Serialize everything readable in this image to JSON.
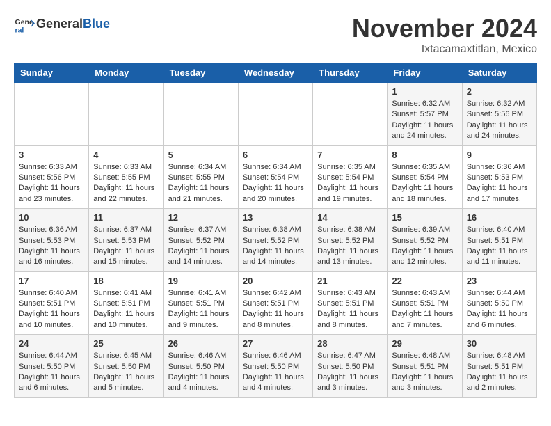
{
  "header": {
    "logo_line1": "General",
    "logo_line2": "Blue",
    "month": "November 2024",
    "location": "Ixtacamaxtitlan, Mexico"
  },
  "days_of_week": [
    "Sunday",
    "Monday",
    "Tuesday",
    "Wednesday",
    "Thursday",
    "Friday",
    "Saturday"
  ],
  "weeks": [
    [
      {
        "day": "",
        "info": ""
      },
      {
        "day": "",
        "info": ""
      },
      {
        "day": "",
        "info": ""
      },
      {
        "day": "",
        "info": ""
      },
      {
        "day": "",
        "info": ""
      },
      {
        "day": "1",
        "info": "Sunrise: 6:32 AM\nSunset: 5:57 PM\nDaylight: 11 hours and 24 minutes."
      },
      {
        "day": "2",
        "info": "Sunrise: 6:32 AM\nSunset: 5:56 PM\nDaylight: 11 hours and 24 minutes."
      }
    ],
    [
      {
        "day": "3",
        "info": "Sunrise: 6:33 AM\nSunset: 5:56 PM\nDaylight: 11 hours and 23 minutes."
      },
      {
        "day": "4",
        "info": "Sunrise: 6:33 AM\nSunset: 5:55 PM\nDaylight: 11 hours and 22 minutes."
      },
      {
        "day": "5",
        "info": "Sunrise: 6:34 AM\nSunset: 5:55 PM\nDaylight: 11 hours and 21 minutes."
      },
      {
        "day": "6",
        "info": "Sunrise: 6:34 AM\nSunset: 5:54 PM\nDaylight: 11 hours and 20 minutes."
      },
      {
        "day": "7",
        "info": "Sunrise: 6:35 AM\nSunset: 5:54 PM\nDaylight: 11 hours and 19 minutes."
      },
      {
        "day": "8",
        "info": "Sunrise: 6:35 AM\nSunset: 5:54 PM\nDaylight: 11 hours and 18 minutes."
      },
      {
        "day": "9",
        "info": "Sunrise: 6:36 AM\nSunset: 5:53 PM\nDaylight: 11 hours and 17 minutes."
      }
    ],
    [
      {
        "day": "10",
        "info": "Sunrise: 6:36 AM\nSunset: 5:53 PM\nDaylight: 11 hours and 16 minutes."
      },
      {
        "day": "11",
        "info": "Sunrise: 6:37 AM\nSunset: 5:53 PM\nDaylight: 11 hours and 15 minutes."
      },
      {
        "day": "12",
        "info": "Sunrise: 6:37 AM\nSunset: 5:52 PM\nDaylight: 11 hours and 14 minutes."
      },
      {
        "day": "13",
        "info": "Sunrise: 6:38 AM\nSunset: 5:52 PM\nDaylight: 11 hours and 14 minutes."
      },
      {
        "day": "14",
        "info": "Sunrise: 6:38 AM\nSunset: 5:52 PM\nDaylight: 11 hours and 13 minutes."
      },
      {
        "day": "15",
        "info": "Sunrise: 6:39 AM\nSunset: 5:52 PM\nDaylight: 11 hours and 12 minutes."
      },
      {
        "day": "16",
        "info": "Sunrise: 6:40 AM\nSunset: 5:51 PM\nDaylight: 11 hours and 11 minutes."
      }
    ],
    [
      {
        "day": "17",
        "info": "Sunrise: 6:40 AM\nSunset: 5:51 PM\nDaylight: 11 hours and 10 minutes."
      },
      {
        "day": "18",
        "info": "Sunrise: 6:41 AM\nSunset: 5:51 PM\nDaylight: 11 hours and 10 minutes."
      },
      {
        "day": "19",
        "info": "Sunrise: 6:41 AM\nSunset: 5:51 PM\nDaylight: 11 hours and 9 minutes."
      },
      {
        "day": "20",
        "info": "Sunrise: 6:42 AM\nSunset: 5:51 PM\nDaylight: 11 hours and 8 minutes."
      },
      {
        "day": "21",
        "info": "Sunrise: 6:43 AM\nSunset: 5:51 PM\nDaylight: 11 hours and 8 minutes."
      },
      {
        "day": "22",
        "info": "Sunrise: 6:43 AM\nSunset: 5:51 PM\nDaylight: 11 hours and 7 minutes."
      },
      {
        "day": "23",
        "info": "Sunrise: 6:44 AM\nSunset: 5:50 PM\nDaylight: 11 hours and 6 minutes."
      }
    ],
    [
      {
        "day": "24",
        "info": "Sunrise: 6:44 AM\nSunset: 5:50 PM\nDaylight: 11 hours and 6 minutes."
      },
      {
        "day": "25",
        "info": "Sunrise: 6:45 AM\nSunset: 5:50 PM\nDaylight: 11 hours and 5 minutes."
      },
      {
        "day": "26",
        "info": "Sunrise: 6:46 AM\nSunset: 5:50 PM\nDaylight: 11 hours and 4 minutes."
      },
      {
        "day": "27",
        "info": "Sunrise: 6:46 AM\nSunset: 5:50 PM\nDaylight: 11 hours and 4 minutes."
      },
      {
        "day": "28",
        "info": "Sunrise: 6:47 AM\nSunset: 5:50 PM\nDaylight: 11 hours and 3 minutes."
      },
      {
        "day": "29",
        "info": "Sunrise: 6:48 AM\nSunset: 5:51 PM\nDaylight: 11 hours and 3 minutes."
      },
      {
        "day": "30",
        "info": "Sunrise: 6:48 AM\nSunset: 5:51 PM\nDaylight: 11 hours and 2 minutes."
      }
    ]
  ]
}
